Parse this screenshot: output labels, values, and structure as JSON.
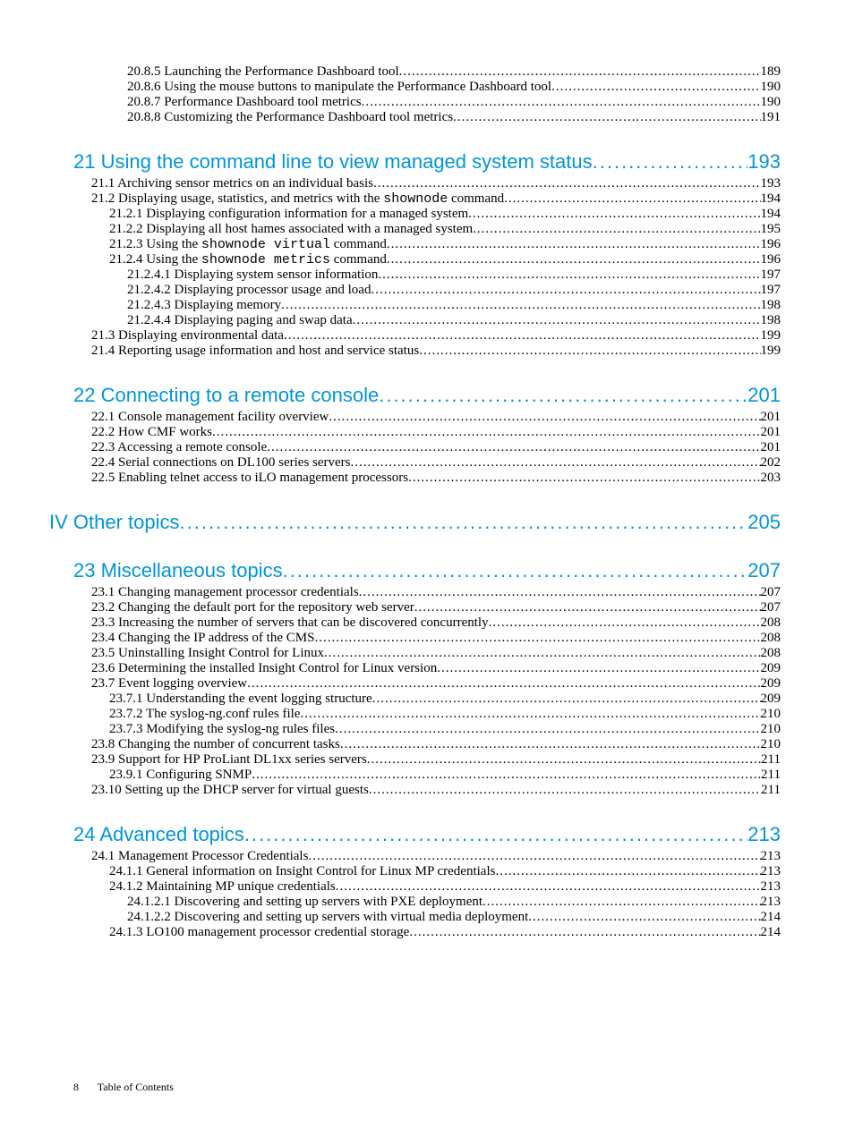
{
  "entries": [
    {
      "type": "item",
      "level": 3,
      "text": "20.8.5 Launching the Performance Dashboard tool",
      "page": "189"
    },
    {
      "type": "item",
      "level": 3,
      "text": "20.8.6 Using the mouse buttons to manipulate the Performance Dashboard tool",
      "page": "190"
    },
    {
      "type": "item",
      "level": 3,
      "text": "20.8.7 Performance Dashboard tool metrics",
      "page": "190"
    },
    {
      "type": "item",
      "level": 3,
      "text": "20.8.8 Customizing the Performance Dashboard tool metrics",
      "page": "191"
    },
    {
      "type": "chapter",
      "text": "21 Using the command line to view managed system status",
      "page": "193"
    },
    {
      "type": "item",
      "level": 1,
      "text": "21.1 Archiving sensor metrics on an individual basis",
      "page": "193"
    },
    {
      "type": "item",
      "level": 1,
      "textParts": [
        {
          "t": "21.2 Displaying usage, statistics, and metrics with the "
        },
        {
          "t": "shownode",
          "mono": true
        },
        {
          "t": " command"
        }
      ],
      "page": "194"
    },
    {
      "type": "item",
      "level": 2,
      "text": "21.2.1 Displaying configuration information for a managed system",
      "page": "194"
    },
    {
      "type": "item",
      "level": 2,
      "text": "21.2.2 Displaying all host hames associated with a managed system",
      "page": "195"
    },
    {
      "type": "item",
      "level": 2,
      "textParts": [
        {
          "t": "21.2.3 Using the "
        },
        {
          "t": "shownode virtual",
          "mono": true
        },
        {
          "t": " command"
        }
      ],
      "page": "196"
    },
    {
      "type": "item",
      "level": 2,
      "textParts": [
        {
          "t": "21.2.4 Using the "
        },
        {
          "t": "shownode metrics",
          "mono": true
        },
        {
          "t": " command"
        }
      ],
      "page": "196"
    },
    {
      "type": "item",
      "level": 3,
      "text": "21.2.4.1 Displaying system sensor information",
      "page": "197"
    },
    {
      "type": "item",
      "level": 3,
      "text": "21.2.4.2 Displaying processor usage and load",
      "page": "197"
    },
    {
      "type": "item",
      "level": 3,
      "text": "21.2.4.3 Displaying memory",
      "page": "198"
    },
    {
      "type": "item",
      "level": 3,
      "text": "21.2.4.4 Displaying paging and swap data ",
      "page": "198"
    },
    {
      "type": "item",
      "level": 1,
      "text": "21.3 Displaying environmental data",
      "page": "199"
    },
    {
      "type": "item",
      "level": 1,
      "text": "21.4 Reporting usage information and host and service status",
      "page": "199"
    },
    {
      "type": "chapter",
      "text": "22 Connecting to a remote console",
      "page": "201"
    },
    {
      "type": "item",
      "level": 1,
      "text": "22.1 Console management facility overview",
      "page": "201"
    },
    {
      "type": "item",
      "level": 1,
      "text": "22.2 How CMF works",
      "page": "201"
    },
    {
      "type": "item",
      "level": 1,
      "text": "22.3 Accessing a remote console",
      "page": "201"
    },
    {
      "type": "item",
      "level": 1,
      "text": "22.4 Serial connections on DL100 series servers",
      "page": "202"
    },
    {
      "type": "item",
      "level": 1,
      "text": "22.5 Enabling telnet access to iLO management processors",
      "page": "203"
    },
    {
      "type": "part",
      "text": "IV Other topics",
      "page": "205"
    },
    {
      "type": "chapter",
      "text": "23 Miscellaneous topics",
      "page": "207"
    },
    {
      "type": "item",
      "level": 1,
      "text": "23.1 Changing management processor credentials",
      "page": "207"
    },
    {
      "type": "item",
      "level": 1,
      "text": "23.2 Changing the default port for the repository web server",
      "page": "207"
    },
    {
      "type": "item",
      "level": 1,
      "text": "23.3 Increasing the number of servers that can be discovered concurrently",
      "page": "208"
    },
    {
      "type": "item",
      "level": 1,
      "text": "23.4 Changing the IP address of the CMS ",
      "page": "208"
    },
    {
      "type": "item",
      "level": 1,
      "text": "23.5 Uninstalling Insight Control for Linux",
      "page": "208"
    },
    {
      "type": "item",
      "level": 1,
      "text": "23.6 Determining the installed Insight Control for Linux version",
      "page": "209"
    },
    {
      "type": "item",
      "level": 1,
      "text": "23.7 Event logging overview",
      "page": "209"
    },
    {
      "type": "item",
      "level": 2,
      "text": "23.7.1 Understanding the event logging structure",
      "page": "209"
    },
    {
      "type": "item",
      "level": 2,
      "text": "23.7.2 The syslog-ng.conf rules file",
      "page": "210"
    },
    {
      "type": "item",
      "level": 2,
      "text": "23.7.3 Modifying the syslog-ng rules files",
      "page": "210"
    },
    {
      "type": "item",
      "level": 1,
      "text": "23.8 Changing the number of concurrent tasks",
      "page": "210"
    },
    {
      "type": "item",
      "level": 1,
      "text": "23.9 Support for HP ProLiant DL1xx series servers",
      "page": "211"
    },
    {
      "type": "item",
      "level": 2,
      "text": "23.9.1 Configuring SNMP",
      "page": "211"
    },
    {
      "type": "item",
      "level": 1,
      "text": "23.10 Setting up the DHCP server for virtual guests",
      "page": "211"
    },
    {
      "type": "chapter",
      "text": "24 Advanced topics",
      "page": "213"
    },
    {
      "type": "item",
      "level": 1,
      "text": "24.1 Management Processor Credentials",
      "page": "213"
    },
    {
      "type": "item",
      "level": 2,
      "text": "24.1.1 General information on Insight Control for Linux MP credentials",
      "page": "213"
    },
    {
      "type": "item",
      "level": 2,
      "text": "24.1.2 Maintaining MP unique credentials",
      "page": "213"
    },
    {
      "type": "item",
      "level": 3,
      "text": "24.1.2.1 Discovering and setting up servers with PXE deployment",
      "page": "213"
    },
    {
      "type": "item",
      "level": 3,
      "text": "24.1.2.2 Discovering and setting up servers with virtual media deployment",
      "page": "214"
    },
    {
      "type": "item",
      "level": 2,
      "text": "24.1.3 LO100 management processor credential storage",
      "page": "214"
    }
  ],
  "footer": {
    "page": "8",
    "label": "Table of Contents"
  }
}
